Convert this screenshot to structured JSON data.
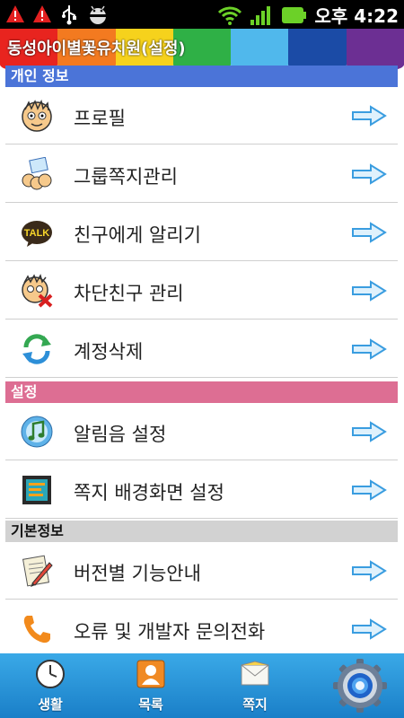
{
  "status_bar": {
    "time": "오후 4:22",
    "icons": [
      "warning-icon",
      "warning-icon",
      "usb-icon",
      "android-debug-icon",
      "wifi-icon",
      "signal-icon",
      "battery-icon"
    ]
  },
  "app": {
    "title": "동성아이별꽃유치원(설정)",
    "stripe_colors": [
      "#e8241f",
      "#f37a20",
      "#f6d21c",
      "#2fb046",
      "#50b8ec",
      "#1b4ba6",
      "#6c2f93"
    ]
  },
  "sections": {
    "personal": {
      "header": "개인 정보",
      "color": "#4b74d8",
      "items": [
        {
          "label": "프로필",
          "icon": "profile-face-icon"
        },
        {
          "label": "그룹쪽지관리",
          "icon": "group-message-icon"
        },
        {
          "label": "친구에게 알리기",
          "icon": "kakaotalk-icon"
        },
        {
          "label": "차단친구 관리",
          "icon": "blocked-friend-icon"
        },
        {
          "label": "계정삭제",
          "icon": "refresh-account-icon"
        }
      ]
    },
    "settings": {
      "header": "설정",
      "color": "#dd6e93",
      "items": [
        {
          "label": "알림음 설정",
          "icon": "music-note-icon"
        },
        {
          "label": "쪽지 배경화면 설정",
          "icon": "wallpaper-icon"
        }
      ]
    },
    "basic": {
      "header": "기본정보",
      "color": "#d2d2d2",
      "items": [
        {
          "label": "버전별 기능안내",
          "icon": "document-pen-icon"
        },
        {
          "label": "오류 및 개발자 문의전화",
          "icon": "phone-icon"
        }
      ]
    }
  },
  "tabbar": {
    "tabs": [
      {
        "label": "생활",
        "icon": "clock-icon"
      },
      {
        "label": "목록",
        "icon": "contacts-icon"
      },
      {
        "label": "쪽지",
        "icon": "envelope-icon"
      },
      {
        "label": "",
        "icon": "settings-gear-icon"
      }
    ]
  }
}
